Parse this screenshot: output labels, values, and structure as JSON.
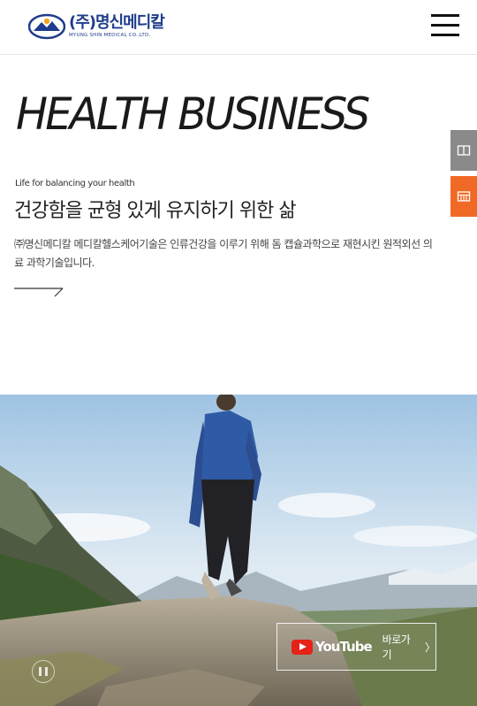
{
  "header": {
    "logo_name": "(주)명신메디칼",
    "logo_sub": "MYUNG SHIN MEDICAL CO.,LTD."
  },
  "intro": {
    "headline": "HEALTH BUSINESS",
    "kicker": "Life for balancing your health",
    "subhead": "건강함을 균형 있게 유지하기 위한 삶",
    "description": "㈜명신메디칼 메디칼헬스케어기술은 인류건강을 이루기 위해 돔 캡슐과학으로 재현시킨 원적외선 의료 과학기술입니다."
  },
  "hero": {
    "youtube_word": "YouTube",
    "youtube_go": "바로가기",
    "youtube_chevron": "〉"
  },
  "colors": {
    "brand": "#1f3d8c",
    "side_tab_gray": "#8a8a8a",
    "side_tab_orange": "#f06a25",
    "youtube_red": "#e62117"
  },
  "icons": {
    "menu": "hamburger-icon",
    "side_tab_1": "book-icon",
    "side_tab_2": "building-icon",
    "youtube": "youtube-play-icon",
    "pause": "pause-icon"
  }
}
